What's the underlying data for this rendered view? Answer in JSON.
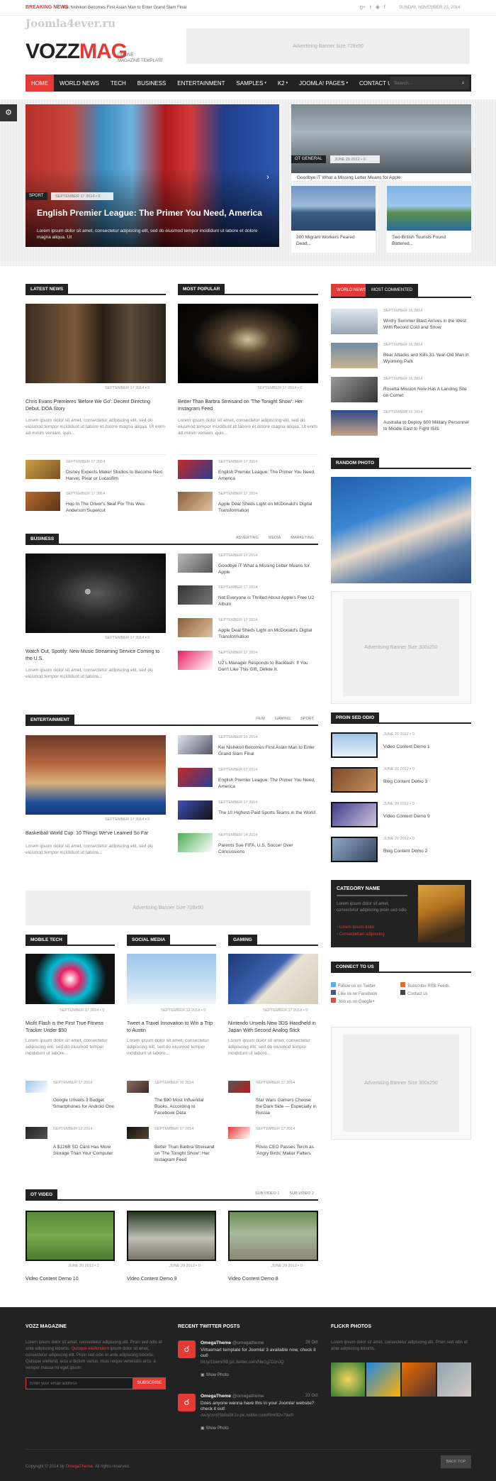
{
  "topbar": {
    "breaking_label": "BREAKING NEWS",
    "breaking_text": "Kei Nishikori Becomes First Asian Man to Enter Grand Slam Final",
    "date": "SUNDAY, NOVEMBER 23, 2014",
    "watermark": "Joomla4ever.ru",
    "social_icons": [
      "google-plus-icon",
      "twitter-icon",
      "rss-icon",
      "facebook-icon"
    ]
  },
  "header": {
    "logo_a": "VOZZ",
    "logo_b": "MAG",
    "tagline_1": "ONLINE",
    "tagline_2": "MAGAZINE TEMPLATE",
    "banner": "Advertising Banner Size 728x90"
  },
  "nav": {
    "items": [
      "HOME",
      "WORLD NEWS",
      "TECH",
      "BUSINESS",
      "ENTERTAINMENT",
      "SAMPLES",
      "K2",
      "JOOMLA! PAGES",
      "CONTACT US"
    ],
    "search_placeholder": "Search..."
  },
  "hero": {
    "main": {
      "tag": "SPORT",
      "date": "SEPTEMBER 17 2014",
      "comments": "0",
      "title": "English Premier League: The Primer You Need, America",
      "excerpt": "Lorem ipsum dolor sit amet, consectetur adipiscing elit, sed do eiusmod tempor incididunt ut labore et dolore magna aliqua. Ut"
    },
    "top_right": {
      "tag": "OT GENERAL",
      "date": "JUNE 20 2012",
      "comments": "0",
      "title": "Goodbye iT What a Missing Letter Means for Apple"
    },
    "small": [
      {
        "title": "300 Migrant Workers Feared Dead..."
      },
      {
        "title": "Two British Tourists Found Battered..."
      }
    ]
  },
  "latest": {
    "label": "LATEST NEWS",
    "feature": {
      "date": "SEPTEMBER 17 2014",
      "comments": "0",
      "title": "Chris Evans Premieres 'Before We Go': Decent Directing Debut, DOA Story",
      "excerpt": "Lorem ipsum dolor sit amet, consectetur adipiscing elit, sed do eiusmod tempor incididunt ut labore et dolore magna aliqua. Ut enim ad minim veniam, quis..."
    },
    "items": [
      {
        "date": "SEPTEMBER 17 2014",
        "title": "Disney Expects Maker Studios to Become Next Harvel, Pixar or Lucasfilm"
      },
      {
        "date": "SEPTEMBER 17 2014",
        "title": "Hop In The Driver's Seat For This Wes Anderson Supercut"
      }
    ]
  },
  "popular": {
    "label": "MOST POPULAR",
    "feature": {
      "date": "SEPTEMBER 17 2014",
      "comments": "0",
      "title": "Better Than Barbra Streisand on 'The Tonight Show': Her Instagram Feed",
      "excerpt": "Lorem ipsum dolor sit amet, consectetur adipiscing elit, sed do eiusmod tempor incididunt ut labore et dolore magna aliqua. Ut enim ad minim veniam, quis..."
    },
    "items": [
      {
        "date": "SEPTEMBER 17 2014",
        "title": "English Premier League: The Primer You Need, America"
      },
      {
        "date": "SEPTEMBER 17 2014",
        "title": "Apple Deal Sheds Light on McDonald's Digital Transformation"
      }
    ]
  },
  "business": {
    "label": "BUSINESS",
    "tabs": [
      "ADVERTING",
      "MEDIA",
      "MARKETING"
    ],
    "feature": {
      "date": "SEPTEMBER 17 2014",
      "comments": "0",
      "title": "Watch Out, Spotify: New Music Streaming Service Coming to the U.S.",
      "excerpt": "Lorem ipsum dolor sit amet, consectetur adipiscing elit, sed do eiusmod tempor incididunt ut labore..."
    },
    "items": [
      {
        "date": "SEPTEMBER 17 2014",
        "title": "Goodbye iT What a Missing Letter Means for Apple"
      },
      {
        "date": "SEPTEMBER 17 2014",
        "title": "Not Everyone is Thrilled About Apple's Free U2 Album"
      },
      {
        "date": "SEPTEMBER 17 2014",
        "title": "Apple Deal Sheds Light on McDonald's Digital Transformation"
      },
      {
        "date": "SEPTEMBER 17 2014",
        "title": "U2's Manager Responds to Backlash: If You Don't Like This Gift, Delete It."
      }
    ]
  },
  "entertainment": {
    "label": "ENTERTAINMENT",
    "tabs": [
      "FILM",
      "GAMING",
      "SPORT"
    ],
    "feature": {
      "date": "SEPTEMBER 17 2014",
      "comments": "0",
      "title": "Basketball World Cup: 10 Things We've Learned So Far",
      "excerpt": "Lorem ipsum dolor sit amet, consectetur adipiscing elit, sed do eiusmod tempor incididunt ut labore..."
    },
    "items": [
      {
        "date": "SEPTEMBER 15 2014",
        "title": "Kei Nishikori Becomes First Asian Man to Enter Grand Slam Final"
      },
      {
        "date": "SEPTEMBER 17 2014",
        "title": "English Premier League: The Primer You Need, America"
      },
      {
        "date": "SEPTEMBER 17 2014",
        "title": "The 10 Highest-Paid Sports Teams in the World"
      },
      {
        "date": "SEPTEMBER 14 2014",
        "title": "Parents Sue FIFA, U.S. Soccer Over Concussions"
      }
    ]
  },
  "mid_banner": "Advertising Banner Size 728x90",
  "three_cols": [
    {
      "label": "MOBILE TECH",
      "feature": {
        "date": "SEPTEMBER 17 2014",
        "comments": "0",
        "title": "Misfit Flash is the First True Fitness Tracker Under $50",
        "excerpt": "Lorem ipsum dolor sit amet, consectetur adipiscing elit, sed do eiusmod tempor incididunt ut labore..."
      },
      "items": [
        {
          "date": "SEPTEMBER 17 2014",
          "title": "Google Unveils 3 Budget Smartphones for Android One"
        },
        {
          "date": "SEPTEMBER 12 2014",
          "title": "A $126B SD Card Has More Storage Than Your Computer"
        }
      ]
    },
    {
      "label": "SOCIAL MEDIA",
      "feature": {
        "date": "SEPTEMBER 13 2014",
        "comments": "0",
        "title": "Tweet a Travel Innovation to Win a Trip to Austin",
        "excerpt": "Lorem ipsum dolor sit amet, consectetur adipiscing elit, sed do eiusmod tempor incididunt ut labore..."
      },
      "items": [
        {
          "date": "SEPTEMBER 16 2014",
          "title": "The $90 Most Influential Books, According to Facebook Data"
        },
        {
          "date": "SEPTEMBER 17 2014",
          "title": "Better Than Barbra Streisand on 'The Tonight Show': Her Instagram Feed"
        }
      ]
    },
    {
      "label": "GAMING",
      "feature": {
        "date": "SEPTEMBER 17 2014",
        "comments": "0",
        "title": "Nintendo Unveils New 3DS Handheld in Japan With Second Analog Stick",
        "excerpt": "Lorem ipsum dolor sit amet, consectetur adipiscing elit, sed do eiusmod tempor incididunt ut labore..."
      },
      "items": [
        {
          "date": "SEPTEMBER 17 2014",
          "title": "Star Wars Gamers Choose the Dark Side — Especially in Russia"
        },
        {
          "date": "SEPTEMBER 17 2014",
          "title": "Rovio CEO Passes Torch as 'Angry Birds' Maker Falters"
        }
      ]
    }
  ],
  "ot_video": {
    "label": "OT VIDEO",
    "tabs": [
      "SUB VIDEO 1",
      "SUB VIDEO 2"
    ],
    "items": [
      {
        "date": "JUNE 20 2012",
        "comments": "3",
        "title": "Video Content Demo 10"
      },
      {
        "date": "JUNE 20 2012",
        "comments": "0",
        "title": "Video Content Demo 9"
      },
      {
        "date": "JUNE 20 2012",
        "comments": "0",
        "title": "Video Content Demo 8"
      }
    ]
  },
  "sidebar": {
    "tabs": [
      "WORLD NEWS",
      "MOST COMMENTED"
    ],
    "news": [
      {
        "date": "SEPTEMBER 16 2014",
        "title": "Wintry Summer Blast Arrives in the West With Record Cold and Snow"
      },
      {
        "date": "SEPTEMBER 16 2014",
        "title": "Bear Attacks and Kills 31-Year-Old Man in Wyoming Park"
      },
      {
        "date": "SEPTEMBER 16 2014",
        "title": "Rosetta Mission Now Has A Landing Site on Comet"
      },
      {
        "date": "SEPTEMBER 16 2014",
        "title": "Australia to Deploy 600 Military Personnel to Middle East to Fight ISIS"
      }
    ],
    "random_photo": "RANDOM PHOTO",
    "banner1": "Advertising Banner Size 300x250",
    "proin": {
      "label": "PROIN SED ODIO",
      "items": [
        {
          "date": "JUNE 20 2012",
          "comments": "0",
          "title": "Video Content Demo 1"
        },
        {
          "date": "JUNE 20 2012",
          "comments": "0",
          "title": "Blog Content Demo 3"
        },
        {
          "date": "JUNE 20 2012",
          "comments": "0",
          "title": "Video Content Demo 9"
        },
        {
          "date": "JUNE 20 2012",
          "comments": "0",
          "title": "Blog Content Demo 2"
        }
      ]
    },
    "category": {
      "title": "CATEGORY NAME",
      "text": "Lorem ipsum dolor sit amet, consectetur adipiscing proin sed odio",
      "links": [
        "Lorem ipsum dolor",
        "Consectetuer adipiscing"
      ]
    },
    "connect": {
      "label": "CONNECT TO US",
      "links": [
        "Follow us on Twitter",
        "Subscribe RSS Feeds",
        "Like us on Facebook",
        "Contact us",
        "Join us on Google+"
      ]
    },
    "banner2": "Advertising Banner Size 300x250"
  },
  "footer": {
    "col1_title": "VOZZ MAGAZINE",
    "col1_text_a": "Lorem ipsum dolor sit amet, consectetur adipiscing elit. Proin sed odio et ante adipiscing lobortis. ",
    "col1_link": "Quisque eleifendem",
    "col1_text_b": " ipsum dolor sit amet, consectetur adipiscing elit. Proin sed odio et ante adipiscing lobortis. Quisque eleifend, arcu a dictum varius, risus neque venenatis arcu, a semper massa mi eget ipsum.",
    "email_placeholder": "Enter your email address",
    "subscribe": "SUBSCRIBE",
    "col2_title": "RECENT TWITTER POSTS",
    "tweets": [
      {
        "name": "OmegaTheme",
        "handle": "@omegatheme",
        "date": "28 Oct",
        "text": "Virtuemart template for Joomla! 3 available now, check it out!",
        "link": "bit.ly/1bwmr9B pic.twitter.com/Nw1g7DznJQ",
        "show": "Show Photo"
      },
      {
        "name": "OmegaTheme",
        "handle": "@omegatheme",
        "date": "23 Oct",
        "text": "Does anyone wanna have this in your Joomla! website? check it out!",
        "link": "ow.ly/zm0Sb0s0KJu pic.twitter.com/RHr0Dv79wR",
        "show": "Show Photo"
      }
    ],
    "col3_title": "FLICKR PHOTOS",
    "col3_text": "Lorem ipsum dolor sit amet, consectetur adipiscing elit. Proin sed odio et ante adipiscing lobortis.",
    "copyright_a": "Copyright © 2014 by ",
    "copyright_link": "OmegaTheme",
    "copyright_b": ". All rights reserved.",
    "back_top": "BACK TOP"
  },
  "colors": {
    "accent": "#e53935",
    "dark": "#222222"
  }
}
